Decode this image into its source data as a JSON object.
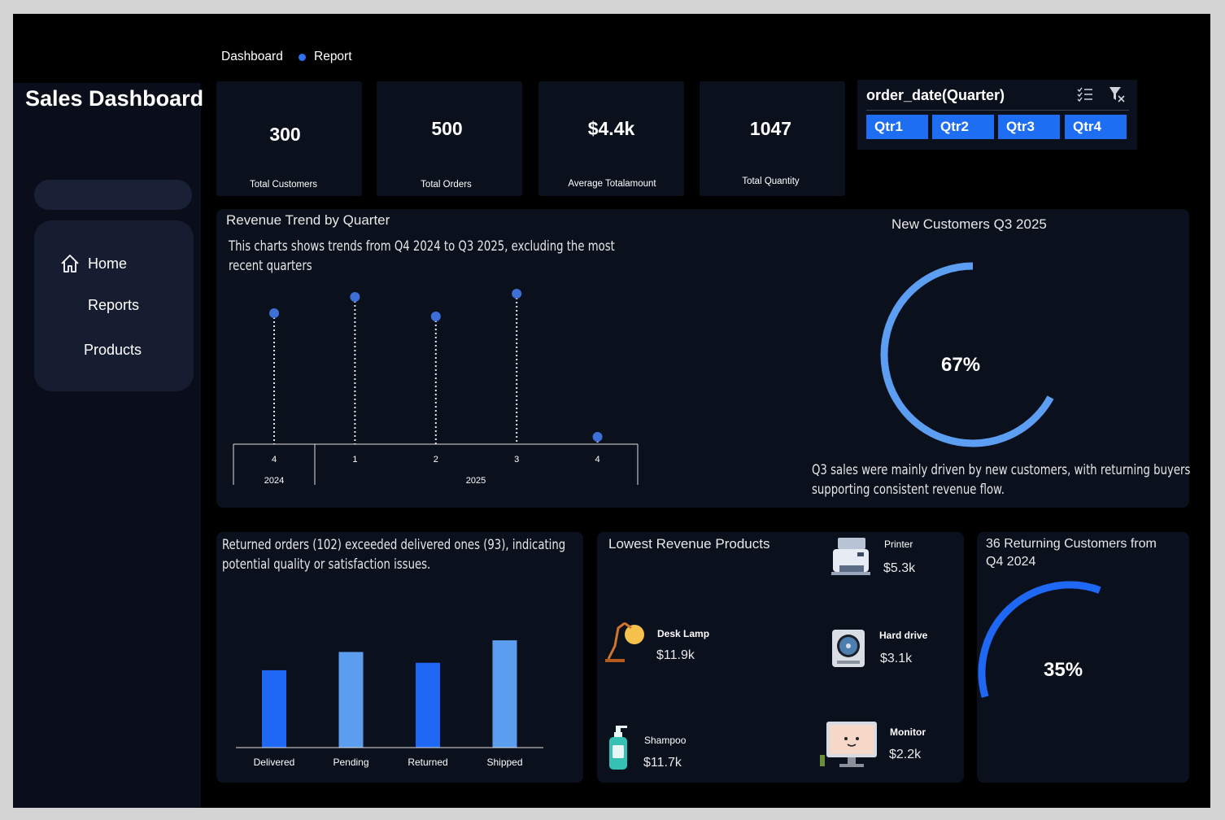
{
  "app": {
    "title": "Sales Dashboard"
  },
  "topnav": {
    "dashboard": "Dashboard",
    "report": "Report"
  },
  "nav": {
    "items": [
      "Home",
      "Reports",
      "Products"
    ]
  },
  "kpis": [
    {
      "value": "300",
      "label": "Total Customers"
    },
    {
      "value": "500",
      "label": "Total Orders"
    },
    {
      "value": "$4.4k",
      "label": "Average Totalamount"
    },
    {
      "value": "1047",
      "label": "Total Quantity"
    }
  ],
  "slicer": {
    "title": "order_date(Quarter)",
    "options": [
      "Qtr1",
      "Qtr2",
      "Qtr3",
      "Qtr4"
    ],
    "accent": "#1e6ef3"
  },
  "revenue_trend": {
    "title": "Revenue Trend by Quarter",
    "note_line1": "This charts shows trends from Q4 2024 to Q3 2025, excluding the most",
    "note_line2": "recent quarters"
  },
  "new_customers": {
    "title": "New Customers Q3 2025",
    "percent_label": "67%",
    "percent": 0.67,
    "note_line1": "Q3 sales were mainly driven by new customers, with returning buyers",
    "note_line2": "supporting consistent revenue flow."
  },
  "order_status": {
    "note_line1": "Returned orders (102) exceeded delivered ones (93), indicating",
    "note_line2": "potential quality or satisfaction issues."
  },
  "lowest_products": {
    "title": "Lowest Revenue Products",
    "items": [
      {
        "name": "Printer",
        "value": "$5.3k",
        "icon": "printer-icon"
      },
      {
        "name": "Desk Lamp",
        "value": "$11.9k",
        "icon": "desk-lamp-icon"
      },
      {
        "name": "Hard drive",
        "value": "$3.1k",
        "icon": "hard-drive-icon"
      },
      {
        "name": "Shampoo",
        "value": "$11.7k",
        "icon": "shampoo-icon"
      },
      {
        "name": "Monitor",
        "value": "$2.2k",
        "icon": "monitor-icon"
      }
    ]
  },
  "returning": {
    "title_line1": "36 Returning Customers from",
    "title_line2": "Q4 2024",
    "percent_label": "35%",
    "percent": 0.35
  },
  "chart_data": [
    {
      "type": "scatter",
      "title": "Revenue Trend by Quarter",
      "x_tick_labels": [
        "4",
        "1",
        "2",
        "3",
        "4"
      ],
      "x_group_labels": [
        "2024",
        "2025"
      ],
      "x": [
        "2024 Q4",
        "2025 Q1",
        "2025 Q2",
        "2025 Q3",
        "2025 Q4"
      ],
      "values": [
        0.78,
        0.88,
        0.76,
        0.9,
        0.02
      ],
      "ylim": [
        0,
        1
      ],
      "grid": false,
      "color": "#3d6fd6"
    },
    {
      "type": "bar",
      "categories": [
        "Delivered",
        "Pending",
        "Returned",
        "Shipped"
      ],
      "values": [
        93,
        115,
        102,
        129
      ],
      "ylim": [
        0,
        180
      ],
      "colors": [
        "#1f67f5",
        "#5b9ef0",
        "#1f67f5",
        "#5b9ef0"
      ]
    }
  ]
}
